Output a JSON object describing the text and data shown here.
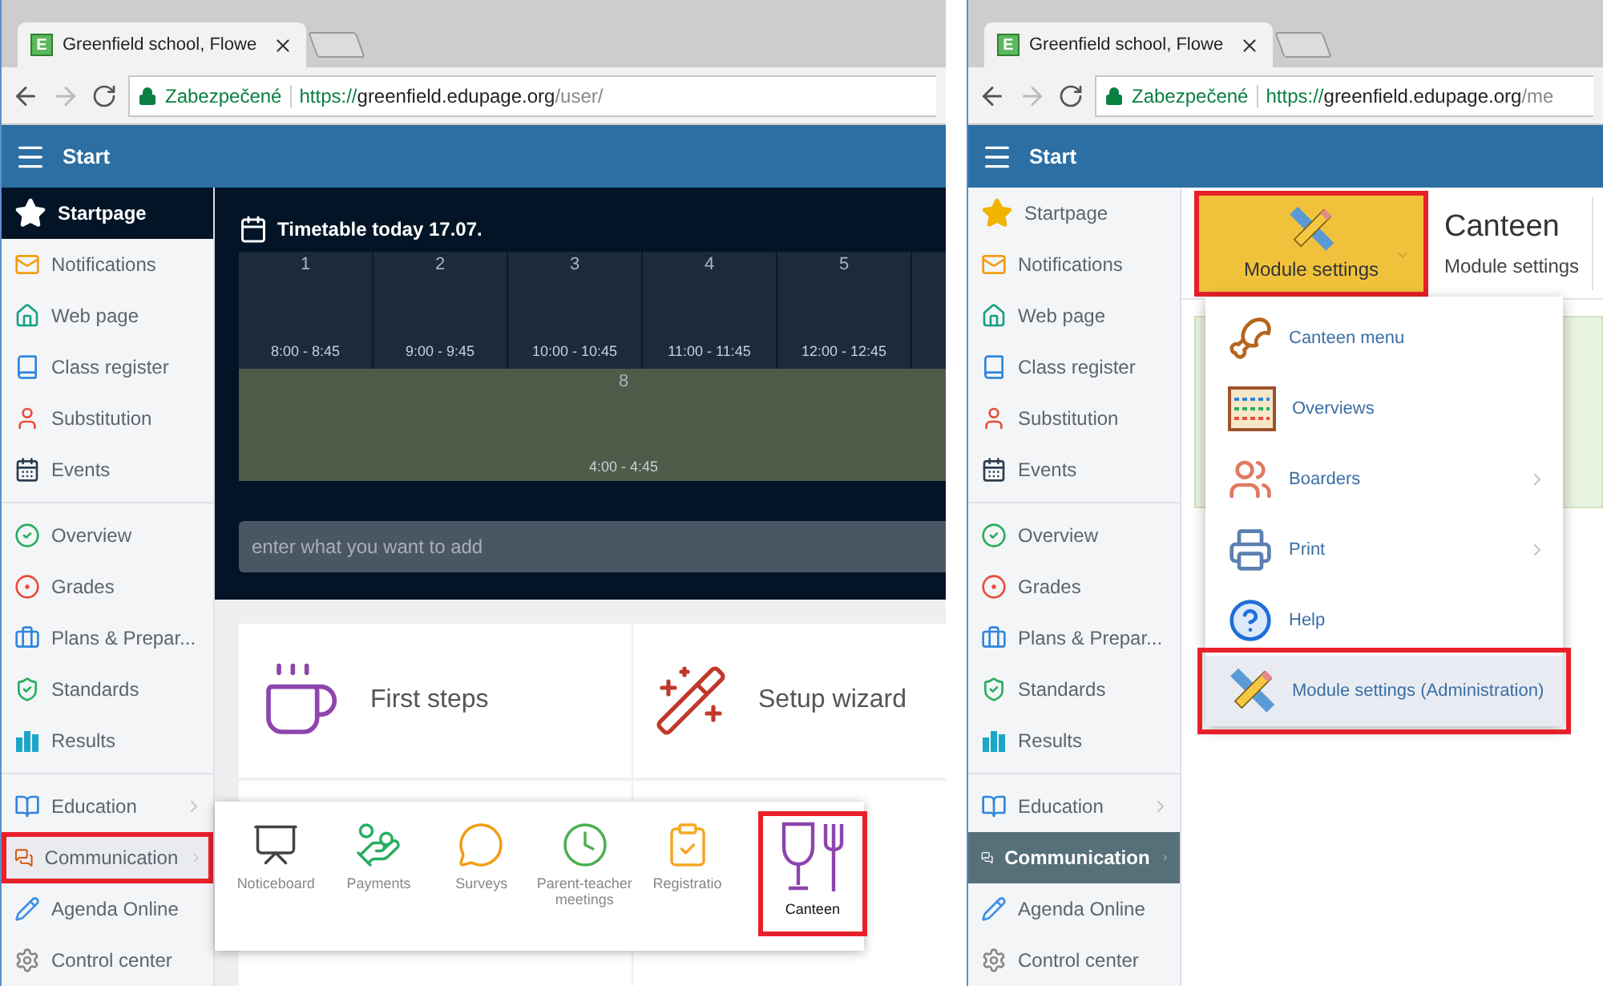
{
  "panels": [
    {
      "kind": "dashboard",
      "browser": {
        "favicon": "E",
        "tab_title": "Greenfield school, Flowe",
        "forward_enabled": false,
        "security": "Zabezpečené",
        "url": {
          "scheme": "https://",
          "host": "greenfield.edupage.org",
          "path": "/user/"
        }
      },
      "header": {
        "title": "Start"
      },
      "sidebar": {
        "groups": [
          {
            "items": [
              {
                "label": "Startpage",
                "selected": true,
                "marked": false,
                "submenu": false
              }
            ]
          },
          {
            "items": [
              {
                "label": "Notifications",
                "selected": false,
                "marked": false,
                "submenu": false
              },
              {
                "label": "Web page",
                "selected": false,
                "marked": false,
                "submenu": false
              },
              {
                "label": "Class register",
                "selected": false,
                "marked": false,
                "submenu": false
              },
              {
                "label": "Substitution",
                "selected": false,
                "marked": false,
                "submenu": false
              },
              {
                "label": "Events",
                "selected": false,
                "marked": false,
                "submenu": false
              }
            ]
          },
          {
            "items": [
              {
                "label": "Overview",
                "selected": false,
                "marked": false,
                "submenu": false
              },
              {
                "label": "Grades",
                "selected": false,
                "marked": false,
                "submenu": false
              },
              {
                "label": "Plans & Prepar...",
                "selected": false,
                "marked": false,
                "submenu": false
              },
              {
                "label": "Standards",
                "selected": false,
                "marked": false,
                "submenu": false
              },
              {
                "label": "Results",
                "selected": false,
                "marked": false,
                "submenu": false
              }
            ]
          },
          {
            "items": [
              {
                "label": "Education",
                "selected": false,
                "marked": false,
                "submenu": true
              },
              {
                "label": "Communication",
                "selected": false,
                "marked": true,
                "submenu": true
              },
              {
                "label": "Agenda Online",
                "selected": false,
                "marked": false,
                "submenu": false
              },
              {
                "label": "Control center",
                "selected": false,
                "marked": false,
                "submenu": false
              }
            ]
          }
        ]
      },
      "timetable": {
        "title": "Timetable today 17.07.",
        "periods": [
          {
            "number": "1",
            "time": "8:00 - 8:45"
          },
          {
            "number": "2",
            "time": "9:00 - 9:45"
          },
          {
            "number": "3",
            "time": "10:00 - 10:45"
          },
          {
            "number": "4",
            "time": "11:00 - 11:45"
          },
          {
            "number": "5",
            "time": "12:00 - 12:45"
          }
        ],
        "extra": {
          "number": "8",
          "time": "4:00 - 4:45"
        }
      },
      "add_field": {
        "placeholder": "enter what you want to add"
      },
      "cards": [
        {
          "label": "First steps"
        },
        {
          "label": "Setup wizard"
        }
      ],
      "popup": {
        "items": [
          {
            "label": "Noticeboard",
            "marked": false
          },
          {
            "label": "Payments",
            "marked": false
          },
          {
            "label": "Surveys",
            "marked": false
          },
          {
            "label": "Parent-teacher meetings",
            "marked": false
          },
          {
            "label": "Registratio",
            "marked": false
          },
          {
            "label": "Canteen",
            "marked": true
          }
        ]
      }
    },
    {
      "kind": "module",
      "browser": {
        "favicon": "E",
        "tab_title": "Greenfield school, Flowe",
        "forward_enabled": false,
        "security": "Zabezpečené",
        "url": {
          "scheme": "https://",
          "host": "greenfield.edupage.org",
          "path": "/me"
        }
      },
      "header": {
        "title": "Start"
      },
      "sidebar": {
        "groups": [
          {
            "items": [
              {
                "label": "Startpage",
                "selected": false,
                "marked": false,
                "submenu": false
              }
            ]
          },
          {
            "items": [
              {
                "label": "Notifications",
                "selected": false,
                "marked": false,
                "submenu": false
              },
              {
                "label": "Web page",
                "selected": false,
                "marked": false,
                "submenu": false
              },
              {
                "label": "Class register",
                "selected": false,
                "marked": false,
                "submenu": false
              },
              {
                "label": "Substitution",
                "selected": false,
                "marked": false,
                "submenu": false
              },
              {
                "label": "Events",
                "selected": false,
                "marked": false,
                "submenu": false
              }
            ]
          },
          {
            "items": [
              {
                "label": "Overview",
                "selected": false,
                "marked": false,
                "submenu": false
              },
              {
                "label": "Grades",
                "selected": false,
                "marked": false,
                "submenu": false
              },
              {
                "label": "Plans & Prepar...",
                "selected": false,
                "marked": false,
                "submenu": false
              },
              {
                "label": "Standards",
                "selected": false,
                "marked": false,
                "submenu": false
              },
              {
                "label": "Results",
                "selected": false,
                "marked": false,
                "submenu": false
              }
            ]
          },
          {
            "items": [
              {
                "label": "Education",
                "selected": false,
                "marked": false,
                "submenu": true
              },
              {
                "label": "Communication",
                "selected": true,
                "marked": false,
                "submenu": true
              },
              {
                "label": "Agenda Online",
                "selected": false,
                "marked": false,
                "submenu": false
              },
              {
                "label": "Control center",
                "selected": false,
                "marked": false,
                "submenu": false
              }
            ]
          }
        ]
      },
      "settings_button": {
        "label": "Module settings",
        "marked": true
      },
      "title": "Canteen",
      "subtitle": "Module settings",
      "menu": {
        "items": [
          {
            "label": "Canteen menu",
            "submenu": false,
            "marked": false
          },
          {
            "label": "Overviews",
            "submenu": false,
            "marked": false
          },
          {
            "label": "Boarders",
            "submenu": true,
            "marked": false
          },
          {
            "label": "Print",
            "submenu": true,
            "marked": false
          },
          {
            "label": "Help",
            "submenu": false,
            "marked": false
          },
          {
            "label": "Module settings (Administration)",
            "submenu": false,
            "marked": true
          }
        ]
      }
    }
  ]
}
